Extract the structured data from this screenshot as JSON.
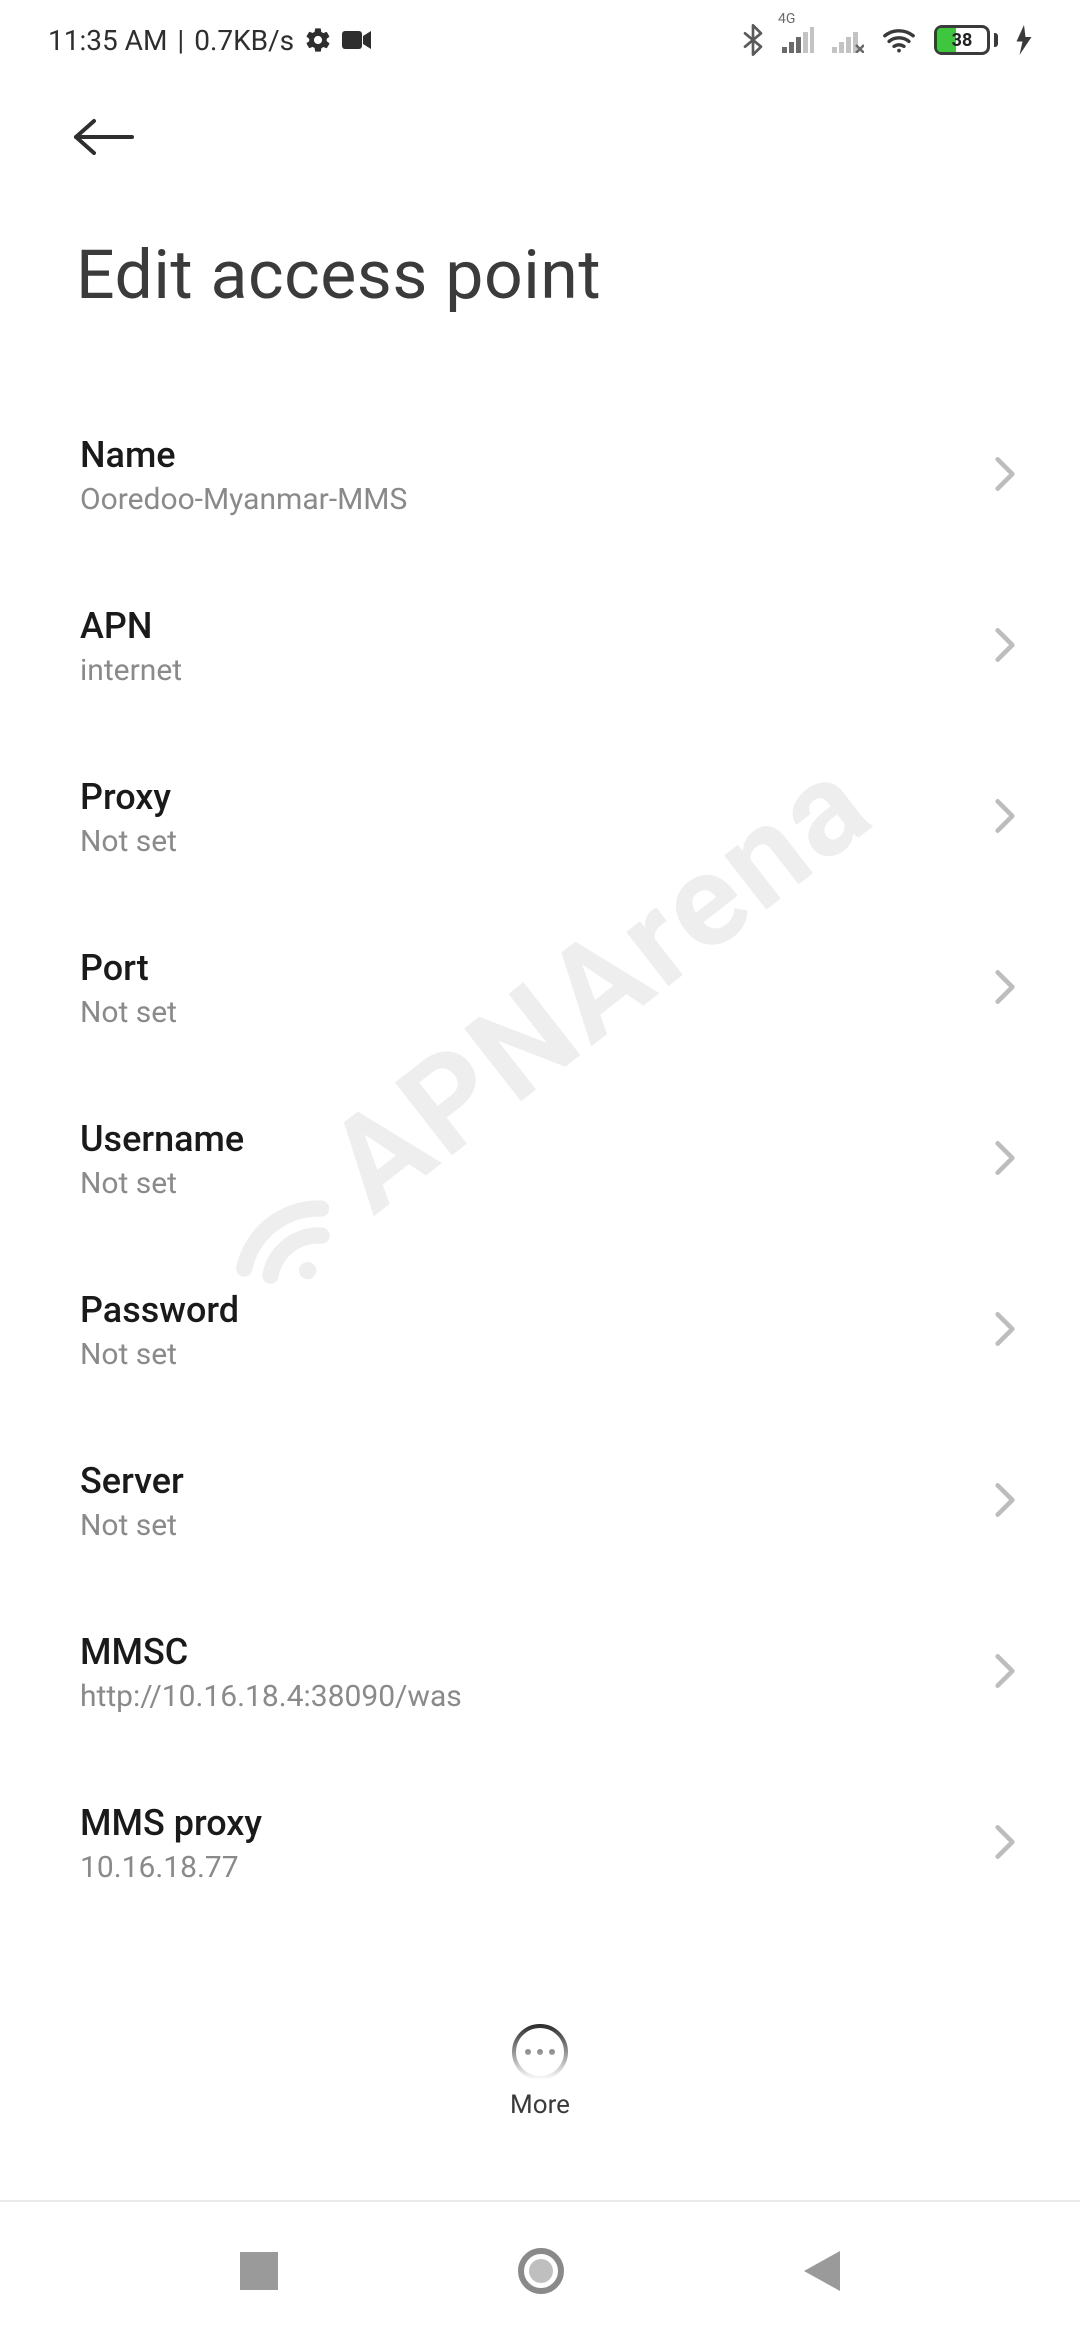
{
  "status": {
    "time": "11:35 AM",
    "sep": "|",
    "speed": "0.7KB/s",
    "network_label": "4G",
    "battery_pct": 38,
    "battery_text": "38"
  },
  "header": {
    "title": "Edit access point"
  },
  "watermark": "APNArena",
  "fields": [
    {
      "label": "Name",
      "value": "Ooredoo-Myanmar-MMS"
    },
    {
      "label": "APN",
      "value": "internet"
    },
    {
      "label": "Proxy",
      "value": "Not set"
    },
    {
      "label": "Port",
      "value": "Not set"
    },
    {
      "label": "Username",
      "value": "Not set"
    },
    {
      "label": "Password",
      "value": "Not set"
    },
    {
      "label": "Server",
      "value": "Not set"
    },
    {
      "label": "MMSC",
      "value": "http://10.16.18.4:38090/was"
    },
    {
      "label": "MMS proxy",
      "value": "10.16.18.77"
    }
  ],
  "more": {
    "label": "More"
  }
}
